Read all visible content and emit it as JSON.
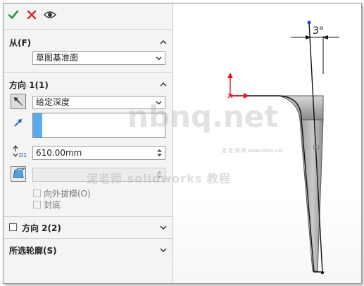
{
  "toolbar": {
    "ok_icon": "checkmark-icon",
    "cancel_icon": "close-icon",
    "preview_icon": "eye-icon"
  },
  "from": {
    "title": "从(F)",
    "selected": "草图基准面"
  },
  "direction1": {
    "title": "方向 1(1)",
    "end_condition": "给定深度",
    "depth": "610.00mm",
    "draft_outward_label": "向外拔模(O)",
    "cap_end_label": "封底"
  },
  "direction2": {
    "title": "方向 2(2)"
  },
  "selected_contours": {
    "title": "所选轮廓(S)"
  },
  "viewport": {
    "angle_label": "3°"
  },
  "watermark": {
    "site": "nbnq.net",
    "small": "泥 老 师 网  www.nbnq.net",
    "caption": "泥老师 solidworks 教程"
  },
  "colors": {
    "accent_blue": "#5aaaf0",
    "ok_green": "#2a9a2a",
    "cancel_red": "#d42a2a",
    "axis_red": "#e0141e"
  }
}
